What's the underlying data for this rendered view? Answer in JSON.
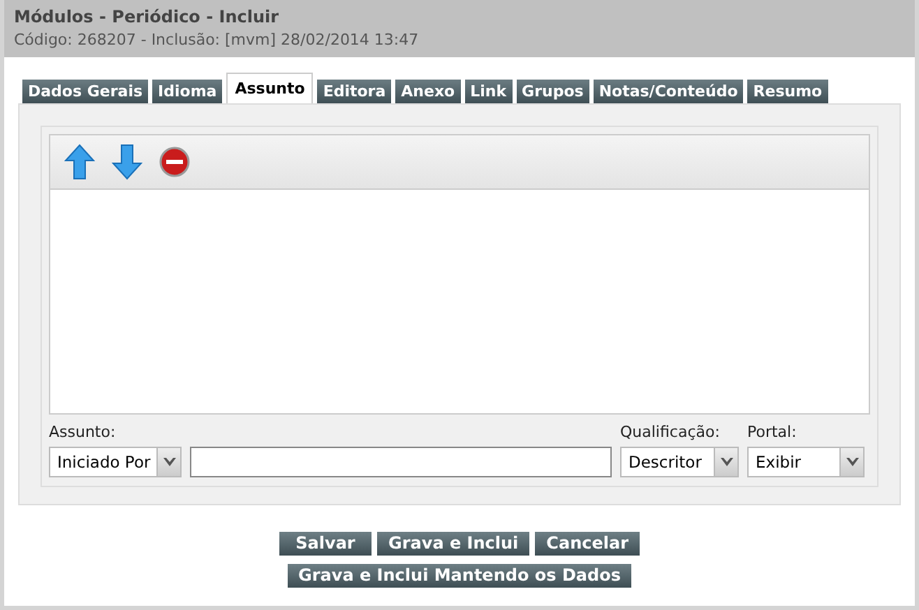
{
  "window": {
    "title": "Módulos - Periódico - Incluir",
    "subtitle": "Código: 268207 - Inclusão: [mvm] 28/02/2014 13:47"
  },
  "tabs": [
    {
      "label": "Dados Gerais",
      "selected": false
    },
    {
      "label": "Idioma",
      "selected": false
    },
    {
      "label": "Assunto",
      "selected": true
    },
    {
      "label": "Editora",
      "selected": false
    },
    {
      "label": "Anexo",
      "selected": false
    },
    {
      "label": "Link",
      "selected": false
    },
    {
      "label": "Grupos",
      "selected": false
    },
    {
      "label": "Notas/Conteúdo",
      "selected": false
    },
    {
      "label": "Resumo",
      "selected": false
    }
  ],
  "toolbar": [
    {
      "kind": "up"
    },
    {
      "kind": "down"
    },
    {
      "kind": "remove"
    }
  ],
  "form": {
    "assunto_label": "Assunto:",
    "assunto_mode": "Iniciado Por",
    "qualificacao_label": "Qualificação:",
    "qualificacao": "Descritor",
    "portal_label": "Portal:",
    "portal": "Exibir"
  },
  "buttons": [
    [
      "Salvar",
      "Grava e Inclui",
      "Cancelar"
    ],
    [
      "Grava e Inclui Mantendo os Dados"
    ]
  ]
}
